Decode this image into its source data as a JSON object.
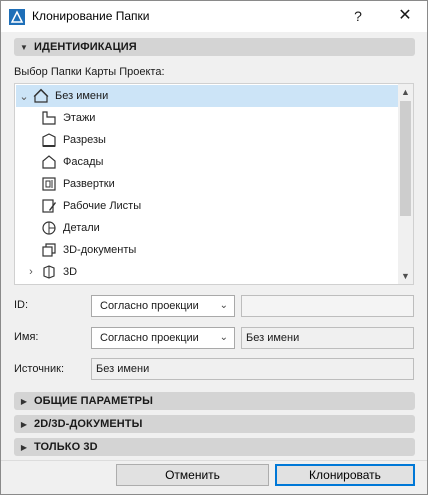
{
  "window": {
    "title": "Клонирование Папки",
    "help_label": "?",
    "close_label": "✕"
  },
  "sections": {
    "identification": "ИДЕНТИФИКАЦИЯ",
    "general": "ОБЩИЕ ПАРАМЕТРЫ",
    "docs_2d3d": "2D/3D-ДОКУМЕНТЫ",
    "only_3d": "ТОЛЬКО 3D"
  },
  "tree": {
    "label": "Выбор Папки Карты Проекта:",
    "items": [
      {
        "label": "Без имени",
        "icon": "house-icon",
        "expanded": true,
        "selected": true
      },
      {
        "label": "Этажи",
        "icon": "stories-icon"
      },
      {
        "label": "Разрезы",
        "icon": "sections-icon"
      },
      {
        "label": "Фасады",
        "icon": "elevations-icon"
      },
      {
        "label": "Развертки",
        "icon": "interior-elevations-icon"
      },
      {
        "label": "Рабочие Листы",
        "icon": "worksheets-icon"
      },
      {
        "label": "Детали",
        "icon": "details-icon"
      },
      {
        "label": "3D-документы",
        "icon": "3d-documents-icon"
      },
      {
        "label": "3D",
        "icon": "3d-icon",
        "collapsed": true
      }
    ]
  },
  "form": {
    "id_label": "ID:",
    "id_combo": "Согласно проекции",
    "id_value": "",
    "name_label": "Имя:",
    "name_combo": "Согласно проекции",
    "name_value": "Без имени",
    "source_label": "Источник:",
    "source_value": "Без имени"
  },
  "buttons": {
    "cancel": "Отменить",
    "clone": "Клонировать"
  },
  "colors": {
    "selection": "#cce4f7",
    "section_bar": "#d4d4d4",
    "primary_border": "#0078d7"
  }
}
